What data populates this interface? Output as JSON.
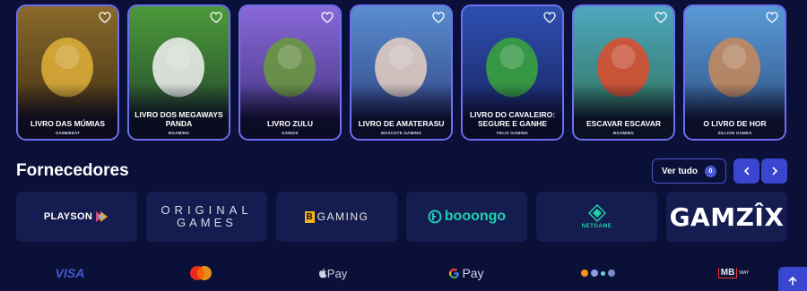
{
  "games": [
    {
      "title": "LIVRO DAS MÚMIAS",
      "provider": "GAMEBEAT",
      "bg_top": "#8a6a2c",
      "bg_bottom": "#3a2a10",
      "accent": "#e0b23a"
    },
    {
      "title": "LIVRO DOS MEGAWAYS PANDA",
      "provider": "BGAMING",
      "bg_top": "#4c9a3a",
      "bg_bottom": "#1f3f2a",
      "accent": "#f2f2f2"
    },
    {
      "title": "LIVRO ZULU",
      "provider": "GAMZIX",
      "bg_top": "#8a68d8",
      "bg_bottom": "#3b2f78",
      "accent": "#6a9c3a"
    },
    {
      "title": "LIVRO DE AMATERASU",
      "provider": "MASCOTE GAMING",
      "bg_top": "#5a8ed0",
      "bg_bottom": "#2a3a7a",
      "accent": "#e8d0c2"
    },
    {
      "title": "LIVRO DO CAVALEIRO: SEGURE E GANHE",
      "provider": "FELIX GAMING",
      "bg_top": "#2f4fb0",
      "bg_bottom": "#14205a",
      "accent": "#3aa83a"
    },
    {
      "title": "ESCAVAR ESCAVAR",
      "provider": "BGAMING",
      "bg_top": "#4fa8c0",
      "bg_bottom": "#2a6a4a",
      "accent": "#e04a2a"
    },
    {
      "title": "O LIVRO DE HOR",
      "provider": "ZILLION GAMES",
      "bg_top": "#5a9ad8",
      "bg_bottom": "#2a4a7a",
      "accent": "#c98a5a"
    }
  ],
  "providers_section": {
    "title": "Fornecedores",
    "see_all_label": "Ver tudo",
    "count": "0"
  },
  "providers": {
    "playson": "PLAYSON",
    "original_line1": "ORIGINAL",
    "original_line2": "GAMES",
    "bgaming_b": "B",
    "bgaming_rest": "GAMING",
    "booongo": "booongo",
    "netgame": "NETGAME",
    "gamzix": "GAMZÎX"
  },
  "payments": {
    "visa": "VISA",
    "apple_pay": "Pay",
    "google_pay": "Pay",
    "mb": "MB",
    "mb_way": "WAY"
  },
  "colors": {
    "background": "#0b1038",
    "card_border": "#6d6ff0",
    "provider_tile": "#151c4f",
    "accent_button": "#3b46d0"
  }
}
